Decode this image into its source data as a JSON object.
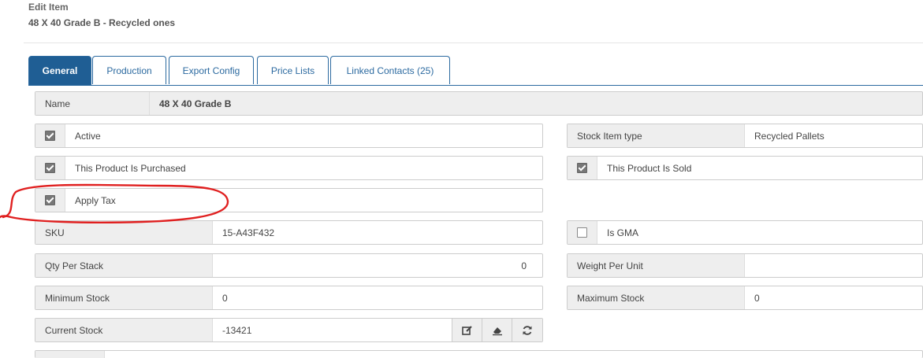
{
  "header": {
    "title": "Edit Item",
    "subtitle": "48 X 40 Grade B - Recycled ones"
  },
  "tabs": [
    {
      "label": "General",
      "active": true
    },
    {
      "label": "Production"
    },
    {
      "label": "Export Config"
    },
    {
      "label": "Price Lists"
    },
    {
      "label": "Linked Contacts (25)"
    }
  ],
  "form": {
    "name": {
      "label": "Name",
      "value": "48 X 40 Grade B"
    },
    "active": {
      "label": "Active",
      "checked": true
    },
    "stock_item_type": {
      "label": "Stock Item type",
      "value": "Recycled Pallets"
    },
    "purchased": {
      "label": "This Product Is Purchased",
      "checked": true
    },
    "sold": {
      "label": "This Product Is Sold",
      "checked": true
    },
    "apply_tax": {
      "label": "Apply Tax",
      "checked": true
    },
    "sku": {
      "label": "SKU",
      "value": "15-A43F432"
    },
    "is_gma": {
      "label": "Is GMA",
      "checked": false
    },
    "qty_per_stack": {
      "label": "Qty Per Stack",
      "value": "0"
    },
    "weight_per_unit": {
      "label": "Weight Per Unit",
      "value": ""
    },
    "minimum_stock": {
      "label": "Minimum Stock",
      "value": "0"
    },
    "maximum_stock": {
      "label": "Maximum Stock",
      "value": "0"
    },
    "current_stock": {
      "label": "Current Stock",
      "value": "-13421"
    }
  },
  "icons": {
    "edit": "edit-icon",
    "eraser": "eraser-icon",
    "refresh": "refresh-icon"
  },
  "colors": {
    "tab_active": "#1f5e94",
    "tab_border": "#2c6aa0",
    "annotation": "#e02020"
  }
}
